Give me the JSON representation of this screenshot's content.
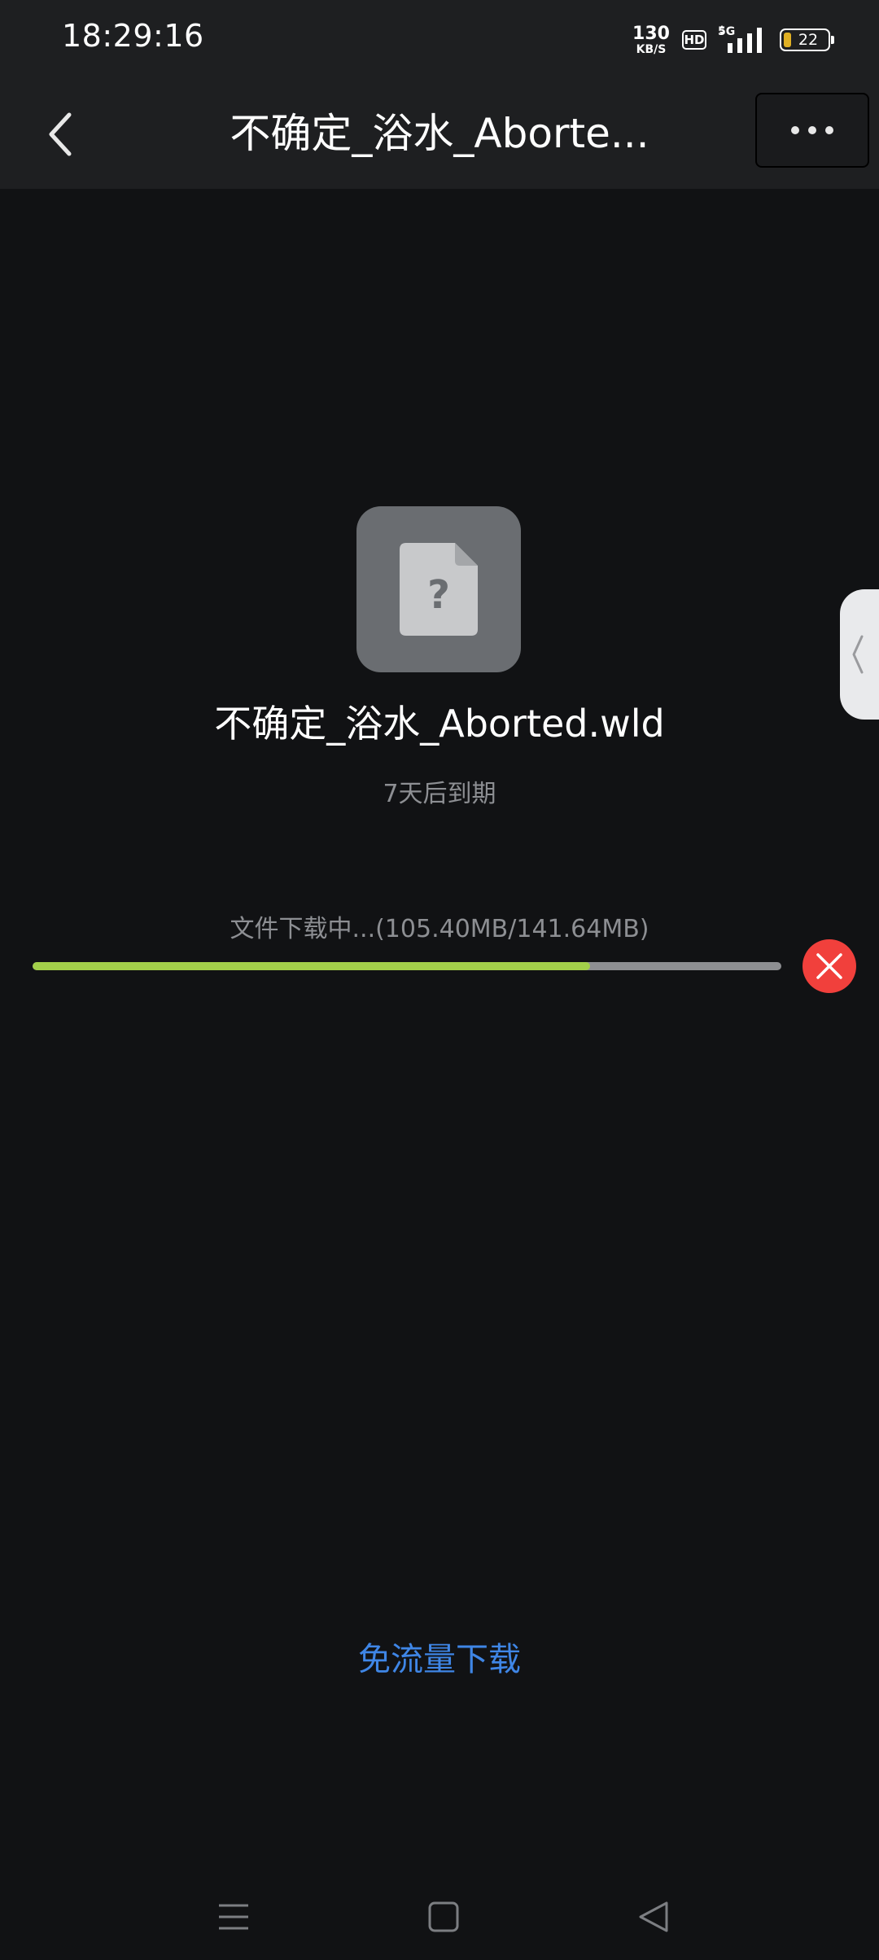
{
  "status_bar": {
    "time": "18:29:16",
    "net_speed_value": "130",
    "net_speed_unit": "KB/S",
    "hd_label": "HD",
    "network_type": "5G",
    "battery_level": "22"
  },
  "app_bar": {
    "title": "不确定_浴水_Aborte...",
    "back_icon": "chevron-left-icon",
    "more_icon": "more-horizontal-icon"
  },
  "file": {
    "icon": "unknown-file-icon",
    "name": "不确定_浴水_Aborted.wld",
    "expiry": "7天后到期"
  },
  "download": {
    "status_text": "文件下载中...(105.40MB/141.64MB)",
    "progress": 0.7441,
    "cancel_icon": "close-icon"
  },
  "free_download_label": "免流量下载",
  "nav_bar": {
    "menu_icon": "menu-icon",
    "home_icon": "home-square-icon",
    "back_icon": "back-triangle-icon"
  },
  "colors": {
    "background": "#111214",
    "bar_background": "#1e1f21",
    "progress_fill": "#a3d04a",
    "progress_track": "#8e8f92",
    "cancel": "#f1403c",
    "link": "#3f86e6"
  }
}
